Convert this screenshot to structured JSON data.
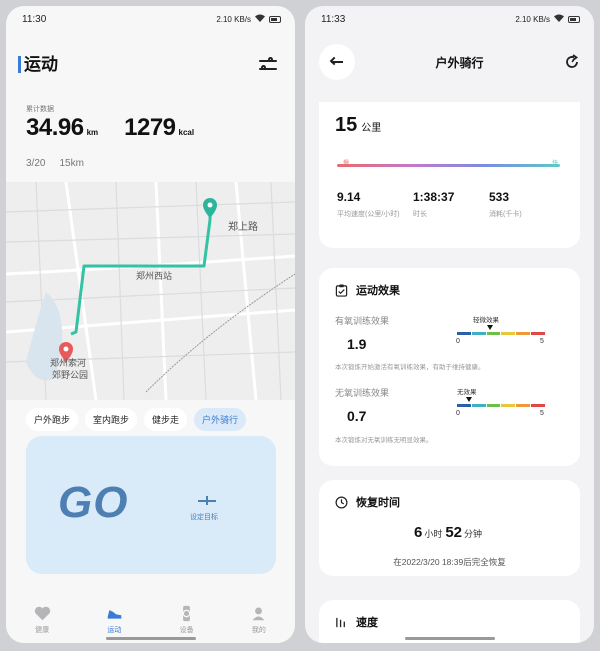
{
  "left": {
    "time": "11:30",
    "status_extra": "2.10 KB/s",
    "title": "运动",
    "cumulative_label": "累计数据",
    "distance_value": "34.96",
    "distance_unit": "km",
    "calorie_value": "1279",
    "calorie_unit": "kcal",
    "date": "3/20",
    "date_distance": "15km",
    "map": {
      "labels": [
        "郑上路",
        "郑州西站",
        "郑州索河",
        "郊野公园"
      ]
    },
    "chips": [
      "户外跑步",
      "室内跑步",
      "健步走",
      "户外骑行"
    ],
    "go_label": "GO",
    "goal_label": "设定目标",
    "nav": [
      "健康",
      "运动",
      "设备",
      "我的"
    ]
  },
  "right": {
    "time": "11:33",
    "status_extra": "2.10 KB/s",
    "title": "户外骑行",
    "distance_value": "15",
    "distance_unit": "公里",
    "pace_slow": "慢",
    "pace_fast": "快",
    "metrics": [
      {
        "value": "9.14",
        "label": "平均速度(公里/小时)"
      },
      {
        "value": "1:38:37",
        "label": "时长"
      },
      {
        "value": "533",
        "label": "消耗(千卡)"
      }
    ],
    "effect": {
      "title": "运动效果",
      "aerobic_label": "有氧训练效果",
      "aerobic_value": "1.9",
      "aerobic_level": "轻微效果",
      "aerobic_note": "本次锻炼开始激活有氧训练效果，有助于维持健康。",
      "anaerobic_label": "无氧训练效果",
      "anaerobic_value": "0.7",
      "anaerobic_level": "无效果",
      "anaerobic_note": "本次锻炼对无氧训练无明显效果。",
      "scale_min": "0",
      "scale_max": "5",
      "aerobic_fraction": 0.38,
      "anaerobic_fraction": 0.14,
      "bar_colors": [
        "#2d5fa8",
        "#3fb0c0",
        "#6cc04a",
        "#e8c83a",
        "#ef9a3a",
        "#e04848"
      ]
    },
    "recovery": {
      "title": "恢复时间",
      "hours": "6",
      "hours_unit": "小时",
      "minutes": "52",
      "minutes_unit": "分钟",
      "note": "在2022/3/20 18:39后完全恢复"
    },
    "speed_title": "速度"
  }
}
